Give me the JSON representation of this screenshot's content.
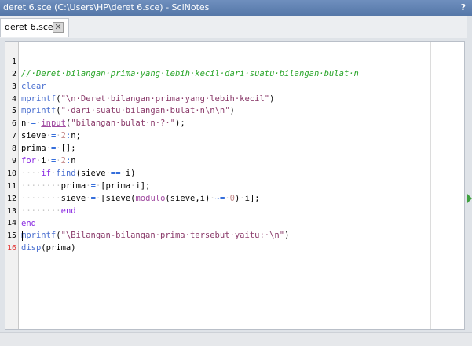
{
  "window": {
    "title": "deret 6.sce (C:\\Users\\HP\\deret 6.sce) - SciNotes",
    "help_label": "?"
  },
  "tabs": [
    {
      "label": "deret 6.sce",
      "close_label": "✕"
    }
  ],
  "editor": {
    "current_line": 16,
    "lines": [
      {
        "n": "1",
        "text": "//·Deret·bilangan·prima·yang·lebih·kecil·dari·suatu·bilangan·bulat·n"
      },
      {
        "n": "2",
        "text": "clear"
      },
      {
        "n": "3",
        "text": "mprintf(\"\\n·Deret·bilangan·prima·yang·lebih·kecil\")"
      },
      {
        "n": "4",
        "text": "mprintf(\"·dari·suatu·bilangan·bulat·n\\n\\n\")"
      },
      {
        "n": "5",
        "text": "n·=·input(\"bilangan·bulat·n·?·\");"
      },
      {
        "n": "6",
        "text": "sieve·=·2:n;"
      },
      {
        "n": "7",
        "text": "prima·=·[];"
      },
      {
        "n": "8",
        "text": "for·i·=·2:n"
      },
      {
        "n": "9",
        "text": "····if·find(sieve·==·i)"
      },
      {
        "n": "10",
        "text": "········prima·=·[prima·i];"
      },
      {
        "n": "11",
        "text": "········sieve·=·[sieve(modulo(sieve,i)·~=·0)·i];"
      },
      {
        "n": "12",
        "text": "········end"
      },
      {
        "n": "13",
        "text": "end"
      },
      {
        "n": "14",
        "text": "mprintf(\"\\Bilangan-bilangan·prima·tersebut·yaitu:·\\n\")"
      },
      {
        "n": "15",
        "text": "disp(prima)"
      },
      {
        "n": "16",
        "text": ""
      }
    ]
  },
  "colors": {
    "comment": "#2aa52a",
    "keyword": "#8a2be2",
    "string": "#8a3a6a",
    "function": "#4a6fd0",
    "title_bar": "#5f80b3"
  }
}
